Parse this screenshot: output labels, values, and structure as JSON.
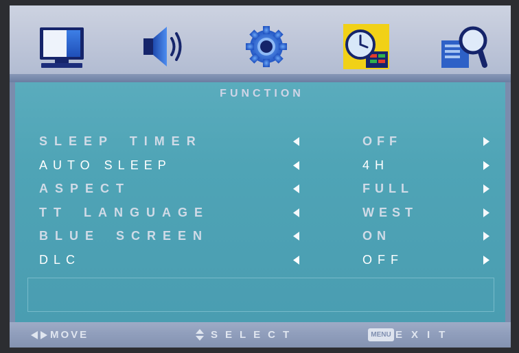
{
  "colors": {
    "tab_bar": "#c1c8da",
    "active_tab": "#f1d117",
    "panel": "#4fa4b6",
    "footer": "#8f9dbb",
    "text_normal": "#d0dbe7",
    "text_highlighted": "#ffffff"
  },
  "tabs": [
    {
      "icon": "picture-icon",
      "active": false
    },
    {
      "icon": "speaker-icon",
      "active": false
    },
    {
      "icon": "gear-icon",
      "active": false
    },
    {
      "icon": "clock-icon",
      "active": true
    },
    {
      "icon": "magnifier-icon",
      "active": false
    }
  ],
  "menu": {
    "title": "FUNCTION",
    "items": [
      {
        "label": "SLEEP TIMER",
        "value": "OFF",
        "highlighted": false
      },
      {
        "label": "AUTO SLEEP",
        "value": "4H",
        "highlighted": true
      },
      {
        "label": "ASPECT",
        "value": "FULL",
        "highlighted": false
      },
      {
        "label": "TT LANGUAGE",
        "value": "WEST",
        "highlighted": false
      },
      {
        "label": "BLUE SCREEN",
        "value": "ON",
        "highlighted": false
      },
      {
        "label": "DLC",
        "value": "OFF",
        "highlighted": true
      }
    ],
    "arrow_icons": {
      "left": "left-arrow-icon",
      "right": "right-arrow-icon"
    }
  },
  "footer": {
    "move_icon": "left-right-arrows-icon",
    "move_label": "MOVE",
    "select_icon": "up-down-arrows-icon",
    "select_label": "SELECT",
    "menu_key": "MENU",
    "exit_label": "EXIT"
  }
}
